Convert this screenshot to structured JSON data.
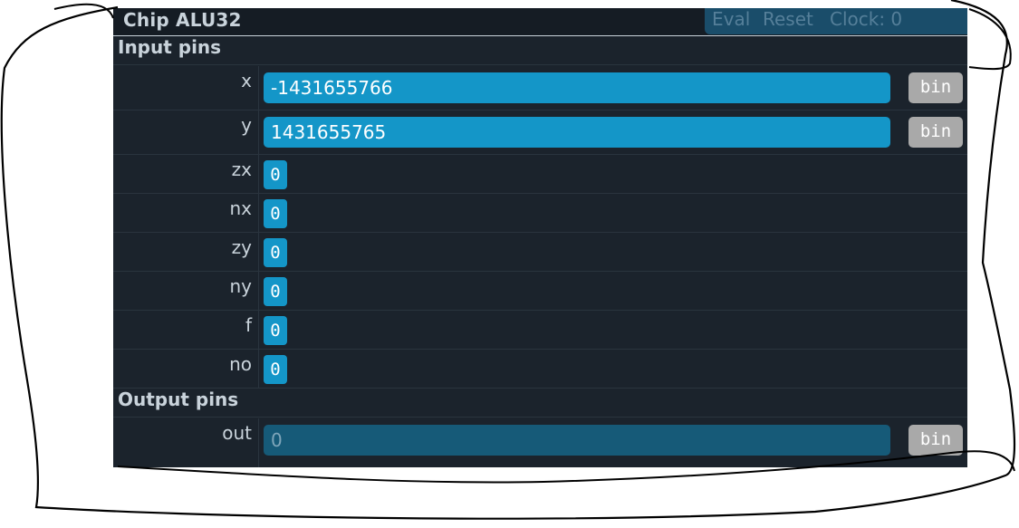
{
  "title": "Chip ALU32",
  "toolbar": {
    "eval": "Eval",
    "reset": "Reset",
    "clock": "Clock: 0"
  },
  "input_section": "Input pins",
  "output_section": "Output pins",
  "inputs": [
    {
      "name": "x",
      "value": "-1431655766",
      "mode": "bin"
    },
    {
      "name": "y",
      "value": "1431655765",
      "mode": "bin"
    },
    {
      "name": "zx",
      "value": "0"
    },
    {
      "name": "nx",
      "value": "0"
    },
    {
      "name": "zy",
      "value": "0"
    },
    {
      "name": "ny",
      "value": "0"
    },
    {
      "name": "f",
      "value": "0"
    },
    {
      "name": "no",
      "value": "0"
    }
  ],
  "outputs": [
    {
      "name": "out",
      "value": "0",
      "mode": "bin"
    }
  ]
}
